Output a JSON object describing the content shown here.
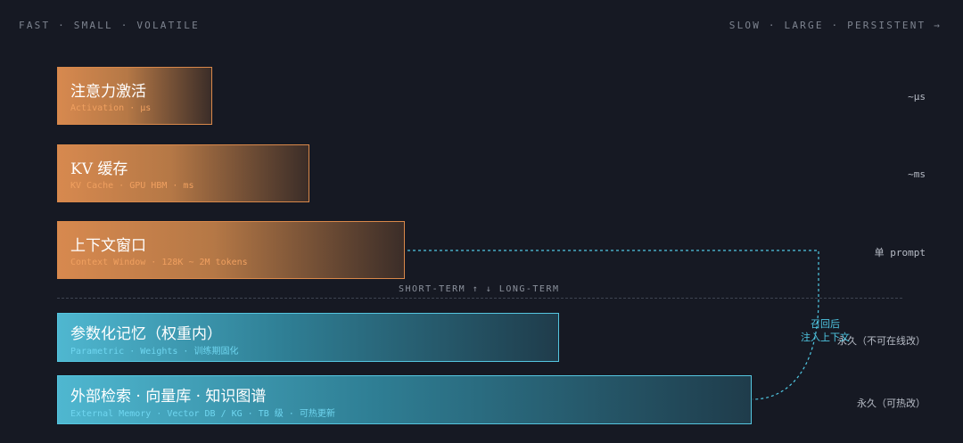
{
  "header": {
    "left": "FAST · SMALL · VOLATILE",
    "right": "SLOW · LARGE · PERSISTENT →"
  },
  "tiers": [
    {
      "title": "注意力激活",
      "subtitle": "Activation · µs",
      "side_label": "~µs"
    },
    {
      "title": "KV 缓存",
      "subtitle": "KV Cache · GPU HBM · ms",
      "side_label": "~ms"
    },
    {
      "title": "上下文窗口",
      "subtitle": "Context Window · 128K ~ 2M tokens",
      "side_label": "单 prompt"
    },
    {
      "title": "参数化记忆（权重内）",
      "subtitle": "Parametric · Weights · 训练期固化",
      "side_label": "永久（不可在线改）"
    },
    {
      "title": "外部检索 · 向量库 · 知识图谱",
      "subtitle": "External Memory · Vector DB / KG · TB 级 · 可热更新",
      "side_label": "永久（可热改）"
    }
  ],
  "divider": "SHORT-TERM ↑ ↓ LONG-TERM",
  "connector": {
    "line1": "召回后",
    "line2": "注入上下文"
  },
  "colors": {
    "background": "#161923",
    "warm_border": "#d9884a",
    "cool_border": "#55c6e0",
    "connector": "#4fc7e3"
  }
}
